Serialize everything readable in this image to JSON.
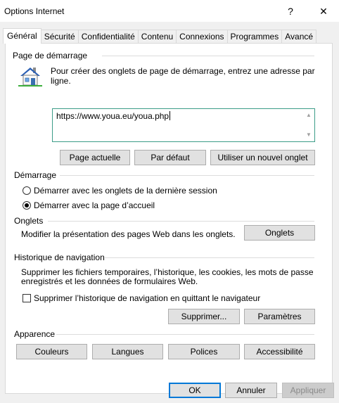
{
  "window": {
    "title": "Options Internet",
    "help": "?",
    "close": "✕"
  },
  "tabs": [
    "Général",
    "Sécurité",
    "Confidentialité",
    "Contenu",
    "Connexions",
    "Programmes",
    "Avancé"
  ],
  "homepage": {
    "label": "Page de démarrage",
    "description": "Pour créer des onglets de page de démarrage, entrez une adresse par ligne.",
    "url": "https://www.youa.eu/youa.php",
    "buttons": {
      "current": "Page actuelle",
      "default": "Par défaut",
      "new_tab": "Utiliser un nouvel onglet"
    }
  },
  "startup": {
    "label": "Démarrage",
    "option_last_session": "Démarrer avec les onglets de la dernière session",
    "option_home_page": "Démarrer avec la page d’accueil",
    "selected": "home_page"
  },
  "tabs_section": {
    "label": "Onglets",
    "description": "Modifier la présentation des pages Web dans les onglets.",
    "button": "Onglets"
  },
  "history": {
    "label": "Historique de navigation",
    "description_line1": "Supprimer les fichiers temporaires, l’historique, les cookies, les mots de passe",
    "description_line2": "enregistrés et les données de formulaires Web.",
    "checkbox_label": "Supprimer l’historique de navigation en quittant le navigateur",
    "checkbox_checked": false,
    "delete_button": "Supprimer...",
    "settings_button": "Paramètres"
  },
  "appearance": {
    "label": "Apparence",
    "buttons": {
      "colors": "Couleurs",
      "languages": "Langues",
      "fonts": "Polices",
      "accessibility": "Accessibilité"
    }
  },
  "footer": {
    "ok": "OK",
    "cancel": "Annuler",
    "apply": "Appliquer"
  },
  "colors": {
    "accent": "#0078d7",
    "textbox_border": "#3c9d88",
    "house_roof": "#2a5fb4"
  }
}
